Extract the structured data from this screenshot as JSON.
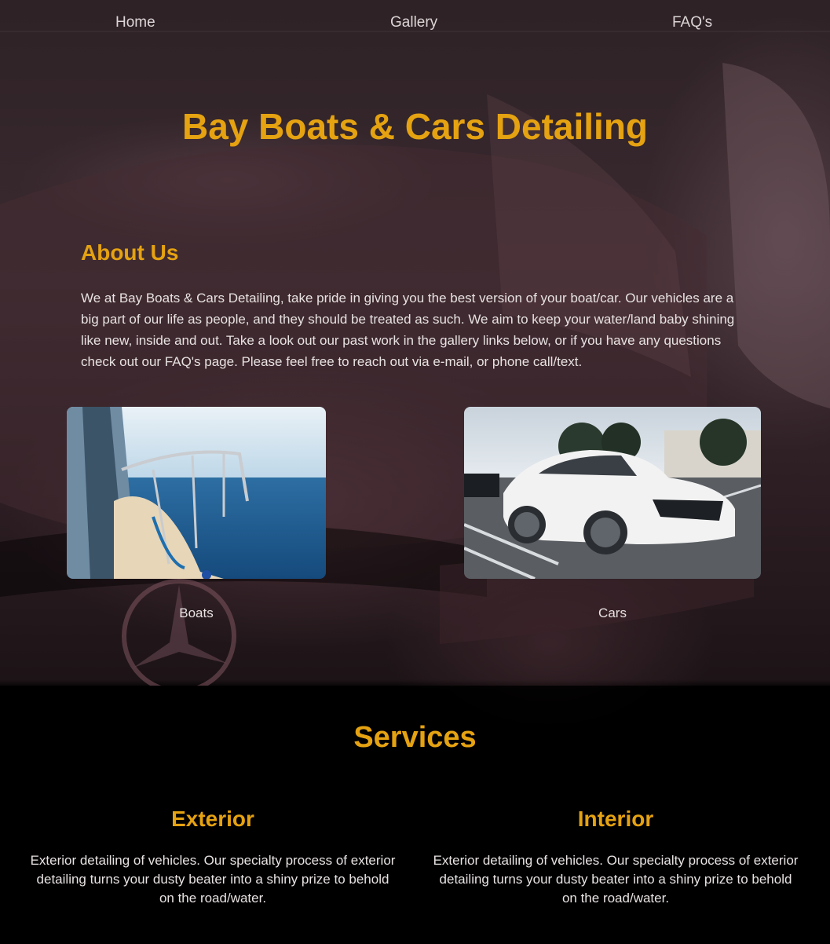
{
  "nav": {
    "items": [
      {
        "label": "Home"
      },
      {
        "label": "Gallery"
      },
      {
        "label": "FAQ's"
      }
    ]
  },
  "hero": {
    "title": "Bay Boats & Cars Detailing"
  },
  "about": {
    "title": "About Us",
    "text": "We at Bay Boats & Cars Detailing, take pride in giving you the best version of your boat/car. Our vehicles are a big part of our life as people, and they should be treated as such. We aim to keep your water/land baby shining like new, inside and out. Take a look out our past work in the gallery links below, or if you have any questions check out our FAQ's page. Please feel free to reach out via e-mail, or phone call/text."
  },
  "gallery": {
    "cards": [
      {
        "label": "Boats",
        "image": "boat-photo"
      },
      {
        "label": "Cars",
        "image": "white-car-photo"
      }
    ]
  },
  "services": {
    "title": "Services",
    "items": [
      {
        "title": "Exterior",
        "text": "Exterior detailing of vehicles. Our specialty process of exterior detailing turns your dusty beater into a shiny prize to behold on the road/water."
      },
      {
        "title": "Interior",
        "text": "Exterior detailing of vehicles. Our specialty process of exterior detailing turns your dusty beater into a shiny prize to behold on the road/water."
      }
    ]
  },
  "colors": {
    "accent": "#e5a211",
    "text": "#e8e2e2",
    "background": "#050304"
  }
}
